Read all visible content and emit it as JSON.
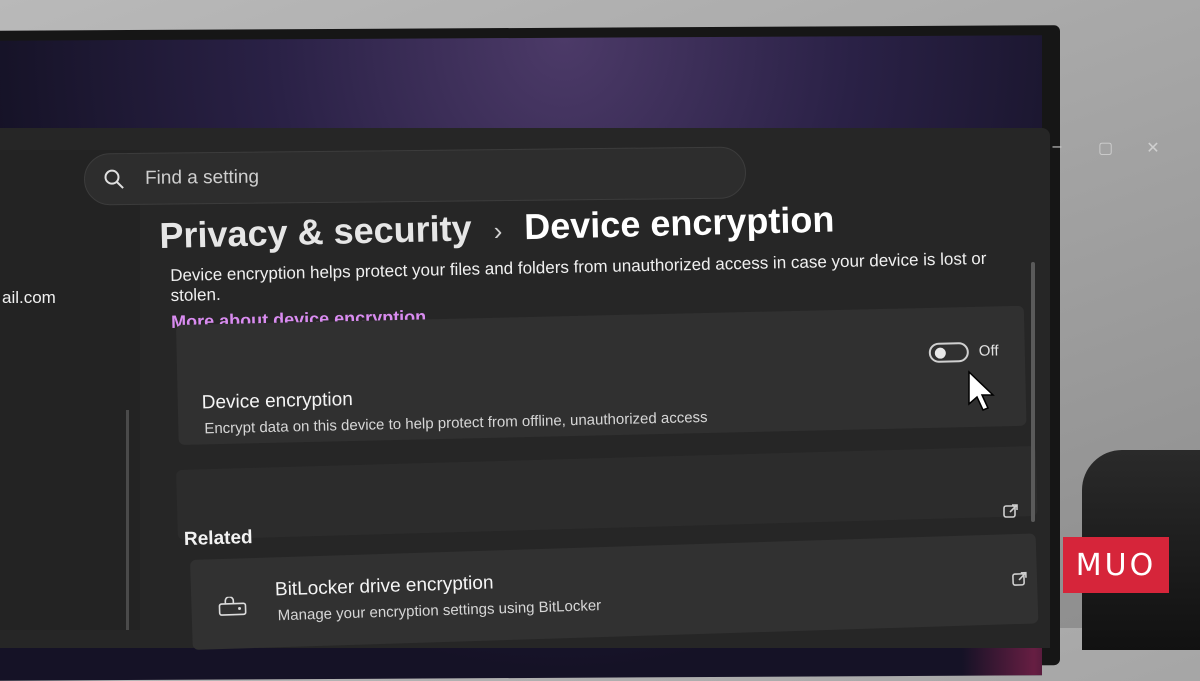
{
  "search": {
    "placeholder": "Find a setting"
  },
  "account": {
    "email_fragment": "ail.com"
  },
  "breadcrumb": {
    "parent": "Privacy & security",
    "separator": "›",
    "current": "Device encryption"
  },
  "intro": {
    "text": "Device encryption helps protect your files and folders from unauthorized access in case your device is lost or stolen.",
    "link": "More about device encryption"
  },
  "device_encryption": {
    "title": "Device encryption",
    "description": "Encrypt data on this device to help protect from offline, unauthorized access",
    "toggle_state": "Off"
  },
  "related": {
    "label": "Related",
    "items": [
      {
        "title": "BitLocker drive encryption",
        "description": "Manage your encryption settings using BitLocker"
      }
    ]
  },
  "watermark": {
    "text": "MUO"
  },
  "colors": {
    "link": "#d98cf0",
    "brand": "#d6253a"
  }
}
